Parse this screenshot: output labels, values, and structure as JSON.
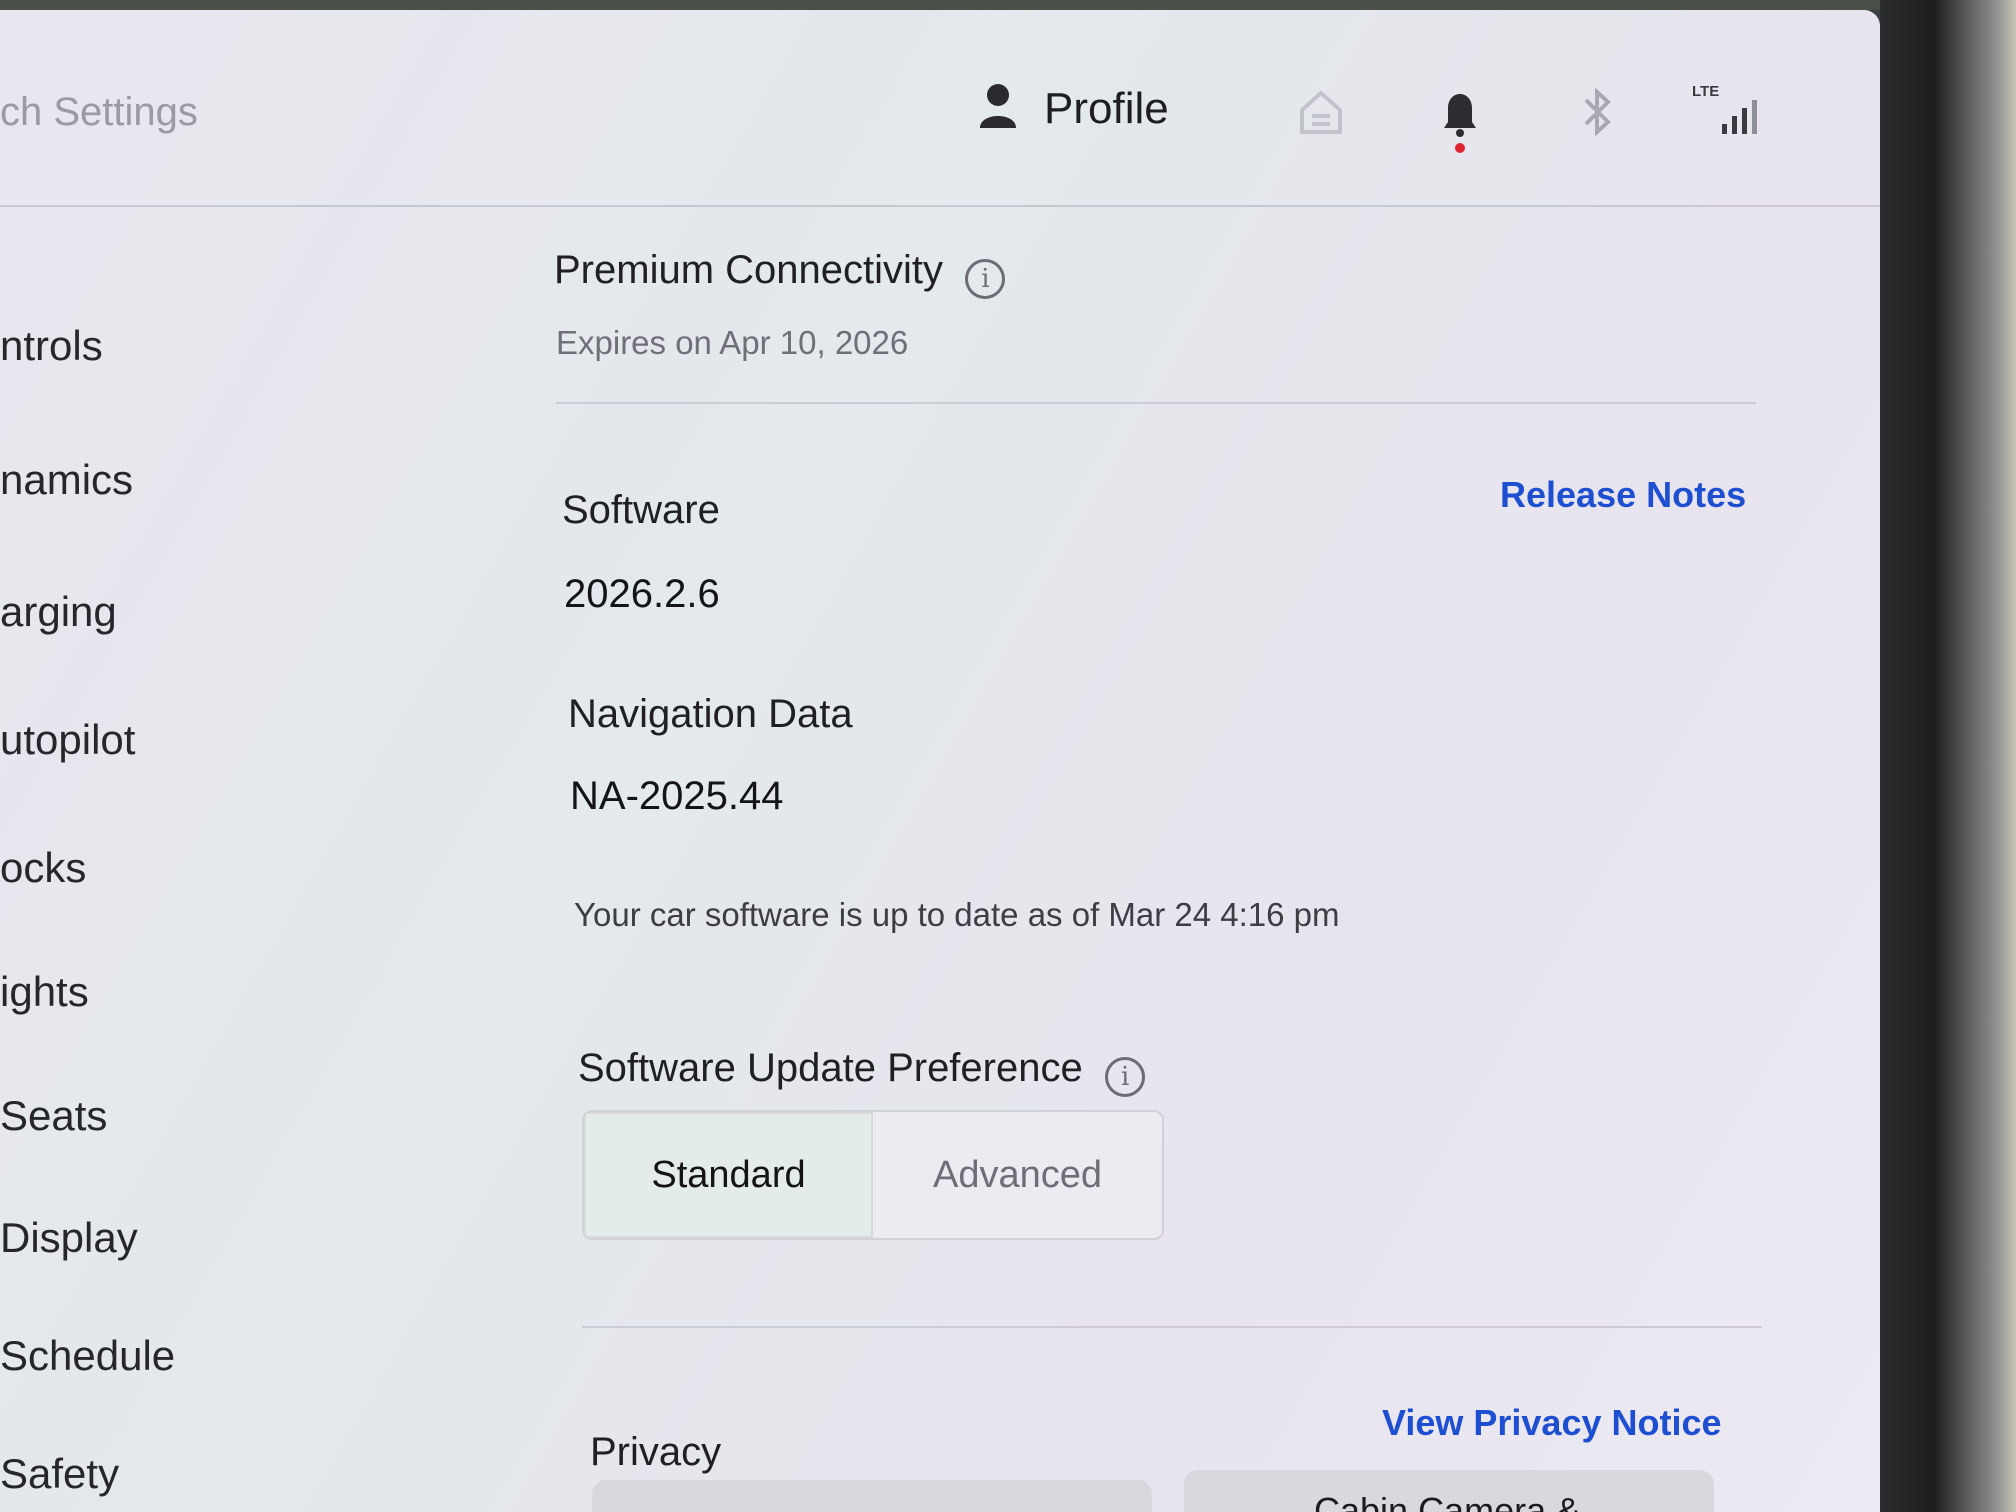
{
  "header": {
    "title": "ch Settings",
    "profile_label": "Profile",
    "status_icons": [
      "home-icon",
      "bell-icon",
      "bluetooth-icon",
      "lte-signal-icon"
    ],
    "lte_label": "LTE"
  },
  "sidebar": {
    "items": [
      {
        "label": "ntrols"
      },
      {
        "label": "namics"
      },
      {
        "label": "arging"
      },
      {
        "label": "utopilot"
      },
      {
        "label": "ocks"
      },
      {
        "label": "ights"
      },
      {
        "label": "Seats"
      },
      {
        "label": "Display"
      },
      {
        "label": "Schedule"
      },
      {
        "label": "Safety"
      }
    ]
  },
  "connectivity": {
    "title": "Premium Connectivity",
    "expires": "Expires on Apr 10, 2026"
  },
  "software": {
    "label": "Software",
    "version": "2026.2.6",
    "release_notes_link": "Release Notes",
    "nav_label": "Navigation Data",
    "nav_version": "NA-2025.44",
    "status_text": "Your car software is up to date as of Mar 24 4:16 pm"
  },
  "update_preference": {
    "label": "Software Update Preference",
    "options": [
      "Standard",
      "Advanced"
    ],
    "selected": "Standard"
  },
  "privacy": {
    "label": "Privacy",
    "notice_link": "View Privacy Notice",
    "cabin_camera_label": "Cabin Camera &"
  },
  "colors": {
    "accent_link": "#1f4fd1",
    "notification_dot": "#e0242f"
  }
}
